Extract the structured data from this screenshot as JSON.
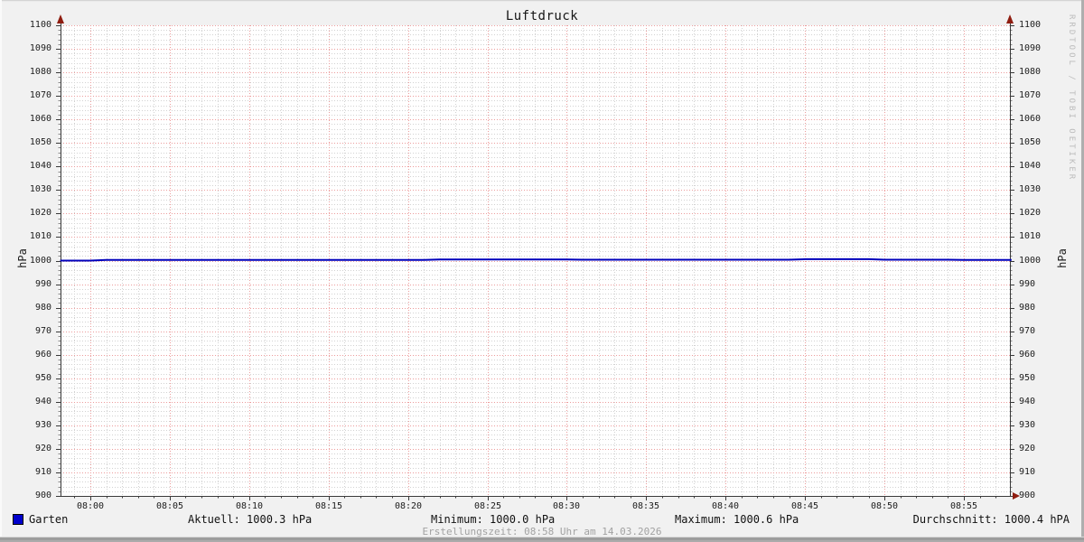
{
  "title": "Luftdruck",
  "watermark": "RRDTOOL / TOBI OETIKER",
  "axis": {
    "y_unit_left": "hPa",
    "y_unit_right": "hPa"
  },
  "legend": {
    "label": "Garten",
    "color": "#0000cc"
  },
  "stats": {
    "aktuell": "Aktuell: 1000.3 hPa",
    "minimum": "Minimum: 1000.0 hPa",
    "maximum": "Maximum: 1000.6 hPa",
    "durchschnitt": "Durchschnitt: 1000.4 hPA"
  },
  "footer": "Erstellungszeit: 08:58 Uhr am 14.03.2026",
  "colors": {
    "canvas_bg": "#f1f1f1",
    "plot_bg": "#ffffff",
    "grid_major": "#ec9c9c",
    "grid_minor": "#d2d2d2",
    "axis": "#3a3a3a",
    "arrow": "#8f1d10",
    "line": "#0000bb",
    "legend_square": "#0000cc",
    "muted_text": "#a2a2a2",
    "watermark_text": "#bcbcbc"
  },
  "chart_data": {
    "type": "line",
    "title": "Luftdruck",
    "xlabel": "",
    "ylabel": "hPa",
    "ylim": [
      900,
      1100
    ],
    "y_major_step": 10,
    "y_minor_step": 2,
    "y_ticks": [
      900,
      910,
      920,
      930,
      940,
      950,
      960,
      970,
      980,
      990,
      1000,
      1010,
      1020,
      1030,
      1040,
      1050,
      1060,
      1070,
      1080,
      1090,
      1100
    ],
    "x_ticks": [
      "08:00",
      "08:05",
      "08:10",
      "08:15",
      "08:20",
      "08:25",
      "08:30",
      "08:35",
      "08:40",
      "08:45",
      "08:50",
      "08:55"
    ],
    "x_minor_step_minutes": 1,
    "x_range_minutes": [
      -1.9,
      58
    ],
    "grid": true,
    "legend_position": "bottom-left",
    "series": [
      {
        "name": "Garten",
        "color": "#0000bb",
        "unit": "hPa",
        "aktuell": 1000.3,
        "minimum": 1000.0,
        "maximum": 1000.6,
        "durchschnitt": 1000.4,
        "points_min_hpa": [
          [
            -1.9,
            1000.0
          ],
          [
            0,
            1000.0
          ],
          [
            1,
            1000.3
          ],
          [
            21,
            1000.3
          ],
          [
            22,
            1000.5
          ],
          [
            30,
            1000.5
          ],
          [
            31,
            1000.4
          ],
          [
            44,
            1000.4
          ],
          [
            45,
            1000.6
          ],
          [
            49,
            1000.6
          ],
          [
            50,
            1000.4
          ],
          [
            54,
            1000.4
          ],
          [
            55,
            1000.3
          ],
          [
            58,
            1000.3
          ]
        ]
      }
    ]
  }
}
